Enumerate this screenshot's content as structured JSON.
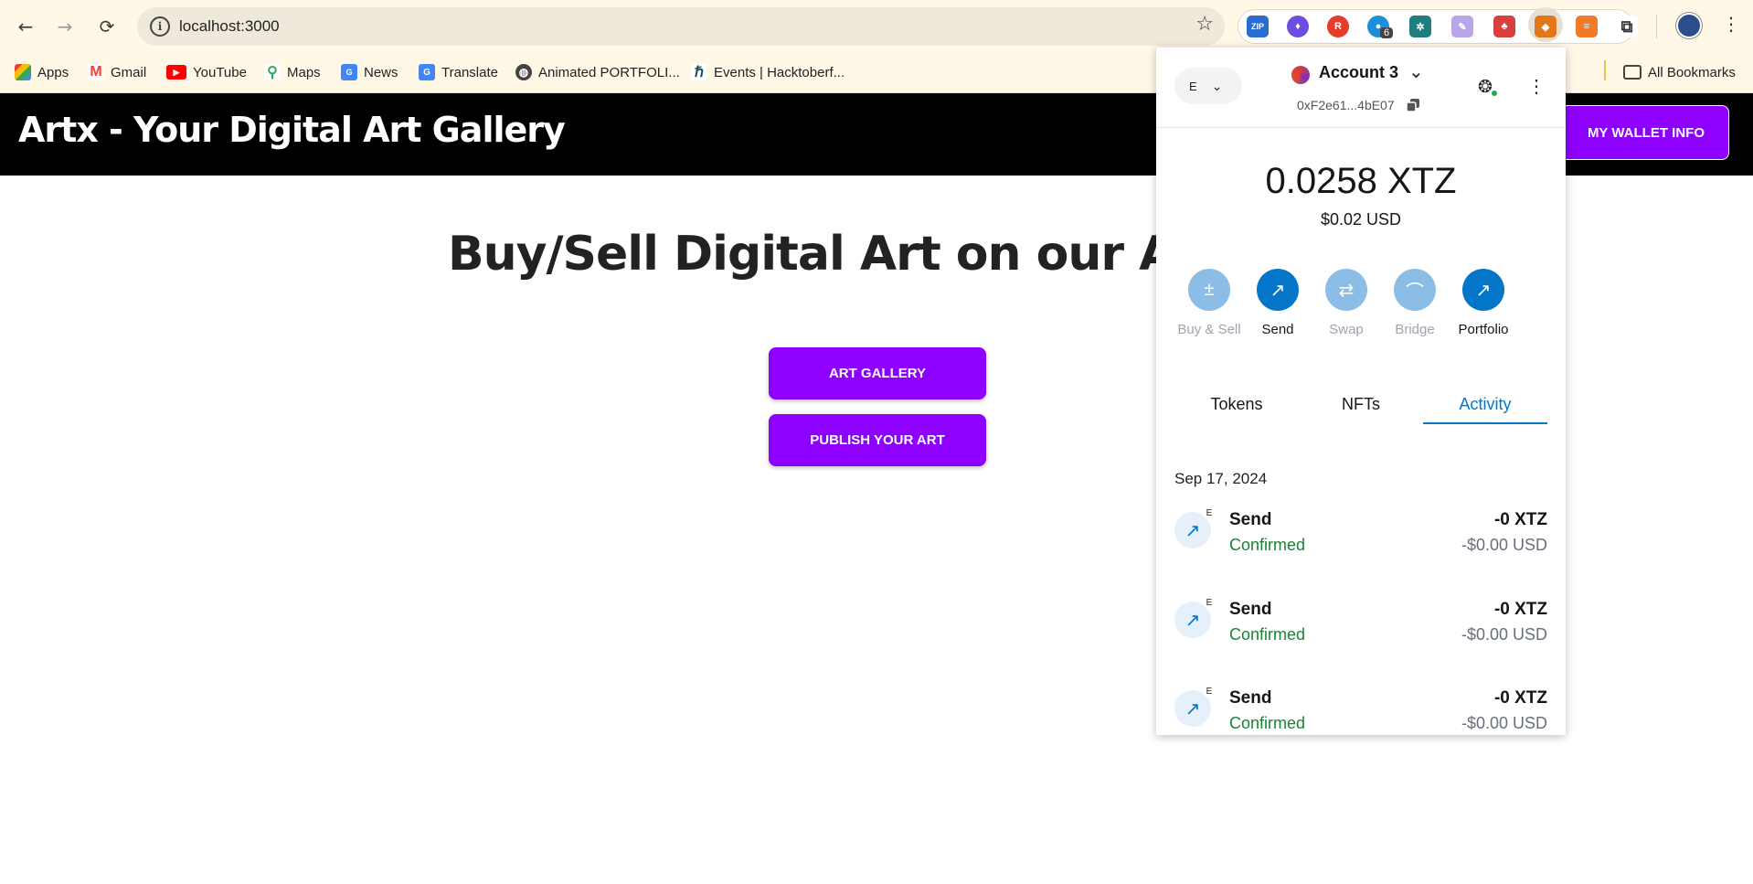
{
  "browser": {
    "url": "localhost:3000",
    "extension_badge": "6",
    "bookmarks": [
      {
        "label": "Apps",
        "icon": "apps-grid-icon"
      },
      {
        "label": "Gmail",
        "icon": "gmail-icon"
      },
      {
        "label": "YouTube",
        "icon": "youtube-icon"
      },
      {
        "label": "Maps",
        "icon": "maps-icon"
      },
      {
        "label": "News",
        "icon": "news-icon"
      },
      {
        "label": "Translate",
        "icon": "translate-icon"
      },
      {
        "label": "Animated PORTFOLI...",
        "icon": "globe-icon"
      },
      {
        "label": "Events | Hacktoberf...",
        "icon": "hacktoberfest-icon"
      }
    ],
    "all_bookmarks": "All Bookmarks"
  },
  "site": {
    "title": "Artx - Your Digital Art Gallery",
    "wallet_button": "MY WALLET INFO",
    "hero": "Buy/Sell Digital Art on our Art Gallery",
    "art_gallery_button": "ART GALLERY",
    "publish_button": "PUBLISH YOUR ART",
    "accent_color": "#8e00ff"
  },
  "wallet": {
    "network_label": "E",
    "account_name": "Account 3",
    "address": "0xF2e61...4bE07",
    "balance": "0.0258 XTZ",
    "balance_usd": "$0.02 USD",
    "actions": [
      {
        "label": "Buy & Sell",
        "icon": "plus-minus-icon",
        "enabled": false
      },
      {
        "label": "Send",
        "icon": "arrow-up-right-icon",
        "enabled": true
      },
      {
        "label": "Swap",
        "icon": "swap-arrows-icon",
        "enabled": false
      },
      {
        "label": "Bridge",
        "icon": "bridge-icon",
        "enabled": false
      },
      {
        "label": "Portfolio",
        "icon": "chart-line-icon",
        "enabled": true
      }
    ],
    "tabs": [
      "Tokens",
      "NFTs",
      "Activity"
    ],
    "active_tab": "Activity",
    "activity_date": "Sep 17, 2024",
    "activity": [
      {
        "title": "Send",
        "status": "Confirmed",
        "amount": "-0 XTZ",
        "usd": "-$0.00 USD",
        "net": "E"
      },
      {
        "title": "Send",
        "status": "Confirmed",
        "amount": "-0 XTZ",
        "usd": "-$0.00 USD",
        "net": "E"
      },
      {
        "title": "Send",
        "status": "Confirmed",
        "amount": "-0 XTZ",
        "usd": "-$0.00 USD",
        "net": "E"
      }
    ]
  }
}
